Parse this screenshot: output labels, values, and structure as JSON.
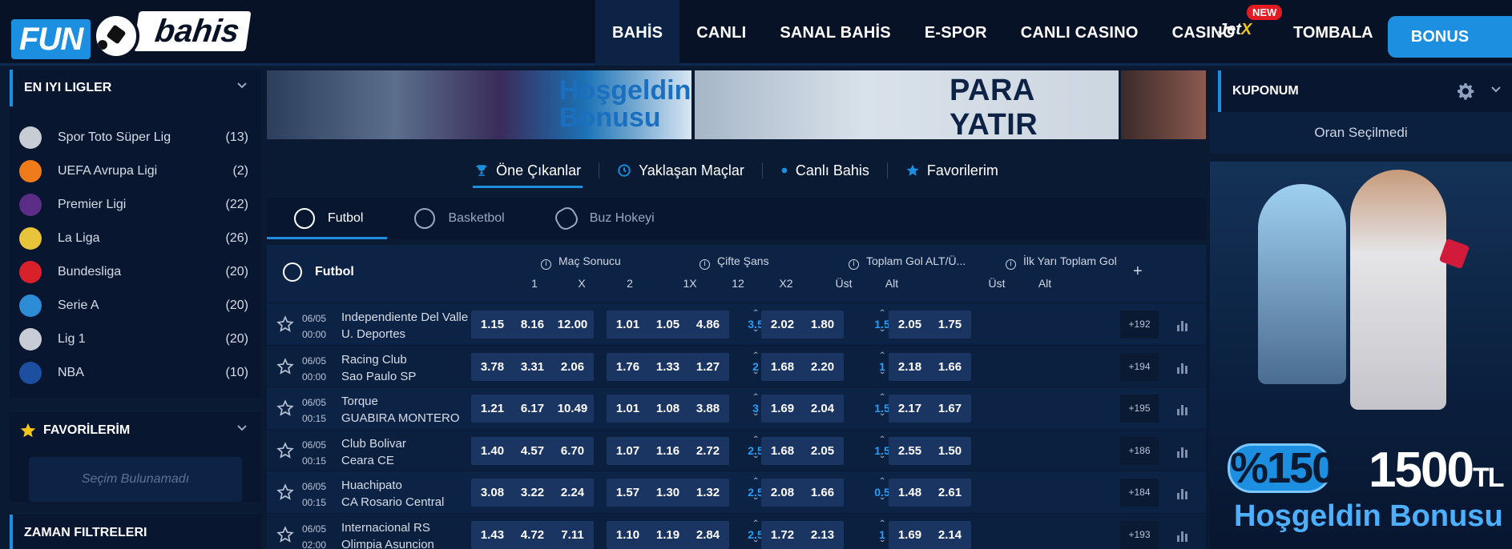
{
  "header": {
    "logo": {
      "part1": "FUN",
      "part2": "bahis"
    },
    "nav": [
      "BAHİS",
      "CANLI",
      "SANAL BAHİS",
      "E-SPOR",
      "CANLI CASINO",
      "CASINO"
    ],
    "jetx": {
      "label": "Jet",
      "accent": "X",
      "badge": "NEW"
    },
    "tombala": "TOMBALA",
    "bonus": "BONUS"
  },
  "sidebar": {
    "leagues_title": "EN IYI LIGLER",
    "leagues": [
      {
        "name": "Spor Toto Süper Lig",
        "count": "(13)",
        "icon_color": "#c8ccd4"
      },
      {
        "name": "UEFA Avrupa Ligi",
        "count": "(2)",
        "icon_color": "#f07b1a"
      },
      {
        "name": "Premier Ligi",
        "count": "(22)",
        "icon_color": "#5b2d86"
      },
      {
        "name": "La Liga",
        "count": "(26)",
        "icon_color": "#e8c43a"
      },
      {
        "name": "Bundesliga",
        "count": "(20)",
        "icon_color": "#d8212b"
      },
      {
        "name": "Serie A",
        "count": "(20)",
        "icon_color": "#2c8cd6"
      },
      {
        "name": "Lig 1",
        "count": "(20)",
        "icon_color": "#c8ccd4"
      },
      {
        "name": "NBA",
        "count": "(10)",
        "icon_color": "#1d4fa0"
      }
    ],
    "favorites_title": "FAVORİLERİM",
    "favorites_empty": "Seçim Bulunamadı",
    "time_filters_title": "ZAMAN FILTRELERI"
  },
  "banners": {
    "b1_line1": "Hoşgeldin",
    "b1_line2": "Bonusu",
    "b2": "PARA YATIR"
  },
  "main_tabs": [
    "Öne Çıkanlar",
    "Yaklaşan Maçlar",
    "Canlı Bahis",
    "Favorilerim"
  ],
  "sport_tabs": [
    "Futbol",
    "Basketbol",
    "Buz Hokeyi"
  ],
  "table": {
    "sport": "Futbol",
    "groups": [
      {
        "title": "Maç Sonucu",
        "subs": [
          "1",
          "X",
          "2"
        ]
      },
      {
        "title": "Çifte Şans",
        "subs": [
          "1X",
          "12",
          "X2"
        ]
      },
      {
        "title": "Toplam Gol ALT/Ü...",
        "subs": [
          "Üst",
          "Alt"
        ]
      },
      {
        "title": "İlk Yarı Toplam Gol",
        "subs": [
          "Üst",
          "Alt"
        ]
      }
    ],
    "plus": "+",
    "matches": [
      {
        "date": "06/05",
        "time": "00:00",
        "home": "Independiente Del Valle",
        "away": "U. Deportes",
        "ms": [
          "1.15",
          "8.16",
          "12.00"
        ],
        "cs": [
          "1.01",
          "1.05",
          "4.86"
        ],
        "tg_line": "3.5",
        "tg": [
          "2.02",
          "1.80"
        ],
        "iy_line": "1.5",
        "iy": [
          "2.05",
          "1.75"
        ],
        "more": "+192"
      },
      {
        "date": "06/05",
        "time": "00:00",
        "home": "Racing Club",
        "away": "Sao Paulo SP",
        "ms": [
          "3.78",
          "3.31",
          "2.06"
        ],
        "cs": [
          "1.76",
          "1.33",
          "1.27"
        ],
        "tg_line": "2",
        "tg": [
          "1.68",
          "2.20"
        ],
        "iy_line": "1",
        "iy": [
          "2.18",
          "1.66"
        ],
        "more": "+194"
      },
      {
        "date": "06/05",
        "time": "00:15",
        "home": "Torque",
        "away": "GUABIRA MONTERO",
        "ms": [
          "1.21",
          "6.17",
          "10.49"
        ],
        "cs": [
          "1.01",
          "1.08",
          "3.88"
        ],
        "tg_line": "3",
        "tg": [
          "1.69",
          "2.04"
        ],
        "iy_line": "1.5",
        "iy": [
          "2.17",
          "1.67"
        ],
        "more": "+195"
      },
      {
        "date": "06/05",
        "time": "00:15",
        "home": "Club Bolivar",
        "away": "Ceara CE",
        "ms": [
          "1.40",
          "4.57",
          "6.70"
        ],
        "cs": [
          "1.07",
          "1.16",
          "2.72"
        ],
        "tg_line": "2.5",
        "tg": [
          "1.68",
          "2.05"
        ],
        "iy_line": "1.5",
        "iy": [
          "2.55",
          "1.50"
        ],
        "more": "+186"
      },
      {
        "date": "06/05",
        "time": "00:15",
        "home": "Huachipato",
        "away": "CA Rosario Central",
        "ms": [
          "3.08",
          "3.22",
          "2.24"
        ],
        "cs": [
          "1.57",
          "1.30",
          "1.32"
        ],
        "tg_line": "2.5",
        "tg": [
          "2.08",
          "1.66"
        ],
        "iy_line": "0.5",
        "iy": [
          "1.48",
          "2.61"
        ],
        "more": "+184"
      },
      {
        "date": "06/05",
        "time": "02:00",
        "home": "Internacional RS",
        "away": "Olimpia Asuncion",
        "ms": [
          "1.43",
          "4.72",
          "7.11"
        ],
        "cs": [
          "1.10",
          "1.19",
          "2.84"
        ],
        "tg_line": "2.5",
        "tg": [
          "1.72",
          "2.13"
        ],
        "iy_line": "1",
        "iy": [
          "1.69",
          "2.14"
        ],
        "more": "+193"
      }
    ]
  },
  "coupon": {
    "title": "KUPONUM",
    "empty": "Oran Seçilmedi"
  },
  "promo": {
    "percent": "%150",
    "amount": "1500",
    "currency": "TL",
    "subtitle": "Hoşgeldin Bonusu"
  },
  "colors": {
    "accent": "#1c8fe0",
    "bg": "#0a1a33",
    "new_badge": "#e51b24"
  }
}
